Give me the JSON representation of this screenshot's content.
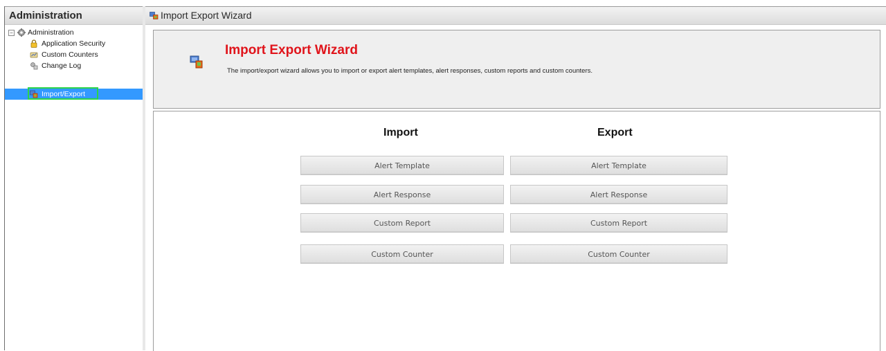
{
  "left_panel": {
    "title": "Administration",
    "tree": {
      "root": {
        "label": "Administration",
        "icon": "gear-icon",
        "expander": "−"
      },
      "items": [
        {
          "label": "Application Security",
          "icon": "lock-icon"
        },
        {
          "label": "Custom Counters",
          "icon": "counter-icon"
        },
        {
          "label": "Change Log",
          "icon": "change-log-icon"
        },
        {
          "label": "Import/Export",
          "icon": "import-export-icon",
          "selected": true
        }
      ]
    }
  },
  "main": {
    "header_title": "Import Export Wizard",
    "banner": {
      "title": "Import Export Wizard",
      "description": "The import/export wizard allows you to import or export alert templates, alert responses, custom reports and custom counters."
    },
    "columns": {
      "import": {
        "heading": "Import",
        "buttons": [
          "Alert Template",
          "Alert Response",
          "Custom Report",
          "Custom Counter"
        ]
      },
      "export": {
        "heading": "Export",
        "buttons": [
          "Alert Template",
          "Alert Response",
          "Custom Report",
          "Custom Counter"
        ]
      }
    }
  },
  "colors": {
    "title_red": "#e0141b",
    "selection_blue": "#3399ff",
    "focus_green": "#2bd44a"
  }
}
